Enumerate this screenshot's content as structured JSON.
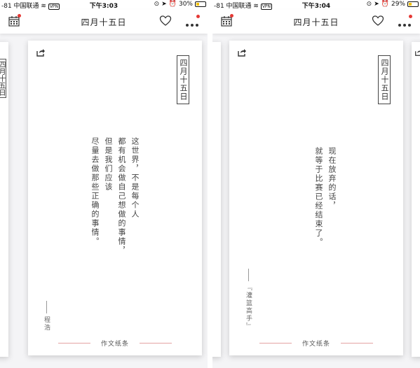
{
  "screens": [
    {
      "status": {
        "carrier": "-81 中国联通",
        "vpn": "VPN",
        "time": "下午3:03",
        "battery_text": "30%",
        "battery_level": 0.3
      },
      "nav": {
        "title": "四月十五日"
      },
      "card": {
        "date": "四月十五日",
        "poem_lines": [
          "这世界，不是每个人",
          "都有机会做自己想做的事情，",
          "但是我们应该",
          "尽量去做那些正确的事情。"
        ],
        "author": "程浩",
        "footer": "作文纸条"
      },
      "peek_left_date": "四月十五日"
    },
    {
      "status": {
        "carrier": "-81 中国联通",
        "vpn": "VPN",
        "time": "下午3:04",
        "battery_text": "29%",
        "battery_level": 0.29
      },
      "nav": {
        "title": "四月十五日"
      },
      "card": {
        "date": "四月十五日",
        "poem_lines": [
          "现在放弃的话，",
          "就等于比赛已经结束了。"
        ],
        "author": "『灌篮高手』",
        "footer": "作文纸条"
      }
    }
  ],
  "icons": {
    "calendar": "calendar-icon",
    "heart": "heart-icon",
    "more": "more-icon",
    "share": "share-icon"
  },
  "colors": {
    "badge": "#e53935",
    "footer_line": "#e4a3a3"
  }
}
